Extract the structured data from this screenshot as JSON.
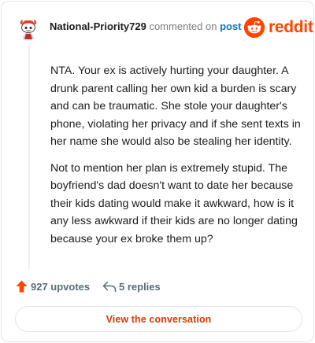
{
  "comment": {
    "author": "National-Priority729",
    "action_text": "commented on",
    "target_link": "post",
    "avatar_icon": "snoo-avatar-icon",
    "paragraphs": [
      "NTA. Your ex is actively hurting your daughter. A drunk parent calling her own kid a burden is scary and can be traumatic. She stole your daughter's phone, violating her privacy and if she sent texts in her name she would also be stealing her identity.",
      "Not to mention her plan is extremely stupid. The boyfriend's dad doesn't want to date her because their kids dating would make it awkward, how is it any less awkward if their kids are no longer dating because your ex broke them up?"
    ],
    "upvotes": "927 upvotes",
    "replies": "5 replies"
  },
  "brand": {
    "name": "reddit",
    "icon": "reddit-logo-icon",
    "color": "#ff4500"
  },
  "cta": {
    "label": "View the conversation",
    "color": "#d93a00"
  },
  "colors": {
    "upvote": "#ff4500",
    "link": "#0079d3",
    "muted": "#576f76"
  }
}
